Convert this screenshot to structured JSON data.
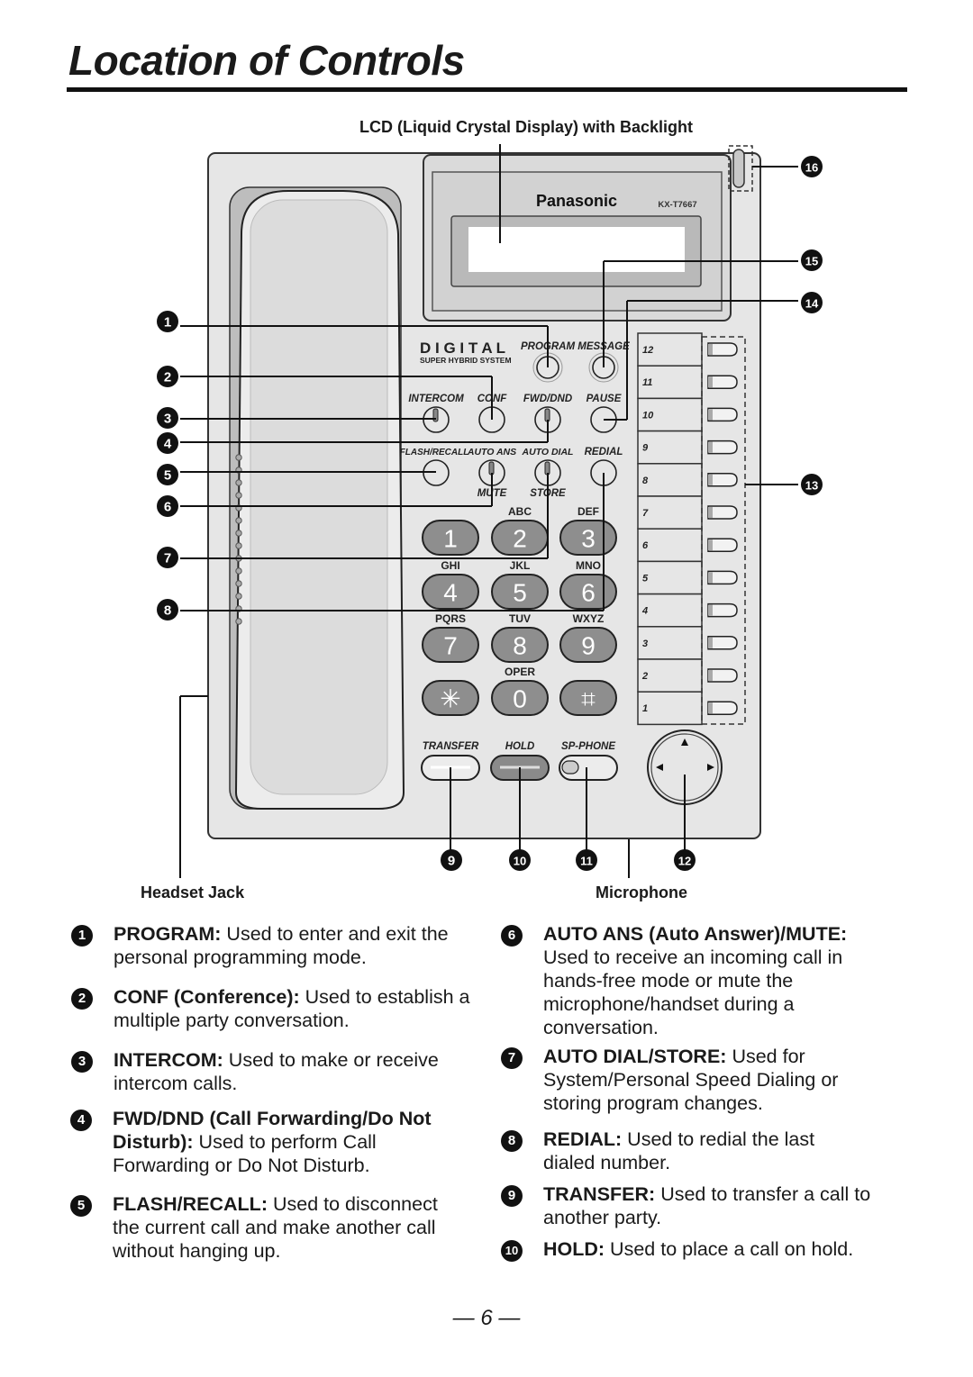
{
  "page": {
    "title": "Location of Controls",
    "page_number": "— 6 —"
  },
  "callouts": {
    "lcd": "LCD (Liquid Crystal Display) with Backlight",
    "headset_jack": "Headset Jack",
    "microphone": "Microphone"
  },
  "phone": {
    "brand": "Panasonic",
    "model": "KX-T7667",
    "series_title": "D I G I T A L",
    "series_subtitle": "SUPER HYBRID SYSTEM",
    "function_buttons": {
      "program": "PROGRAM",
      "message": "MESSAGE",
      "intercom": "INTERCOM",
      "conf": "CONF",
      "fwd_dnd": "FWD/DND",
      "pause": "PAUSE",
      "flash_recall": "FLASH/RECALL",
      "auto_ans": "AUTO ANS",
      "auto_dial": "AUTO DIAL",
      "redial": "REDIAL",
      "mute": "MUTE",
      "store": "STORE",
      "transfer": "TRANSFER",
      "hold": "HOLD",
      "sp_phone": "SP-PHONE"
    },
    "keypad": [
      {
        "digit": "1",
        "letters": ""
      },
      {
        "digit": "2",
        "letters": "ABC"
      },
      {
        "digit": "3",
        "letters": "DEF"
      },
      {
        "digit": "4",
        "letters": "GHI"
      },
      {
        "digit": "5",
        "letters": "JKL"
      },
      {
        "digit": "6",
        "letters": "MNO"
      },
      {
        "digit": "7",
        "letters": "PQRS"
      },
      {
        "digit": "8",
        "letters": "TUV"
      },
      {
        "digit": "9",
        "letters": "WXYZ"
      },
      {
        "digit": "✳",
        "letters": ""
      },
      {
        "digit": "0",
        "letters": "OPER"
      },
      {
        "digit": "⌗",
        "letters": ""
      }
    ],
    "dss_keys": [
      "12",
      "11",
      "10",
      "9",
      "8",
      "7",
      "6",
      "5",
      "4",
      "3",
      "2",
      "1"
    ]
  },
  "badges": [
    "1",
    "2",
    "3",
    "4",
    "5",
    "6",
    "7",
    "8",
    "9",
    "10",
    "11",
    "12",
    "13",
    "14",
    "15",
    "16"
  ],
  "descriptions": [
    {
      "num": "1",
      "term": "PROGRAM:",
      "text": " Used to enter and exit the personal programming mode."
    },
    {
      "num": "2",
      "term": "CONF (Conference):",
      "text": " Used to establish a multiple party conversation."
    },
    {
      "num": "3",
      "term": "INTERCOM:",
      "text": " Used to make or receive intercom calls."
    },
    {
      "num": "4",
      "term": "FWD/DND (Call Forwarding/Do Not Disturb):",
      "text": " Used to perform Call Forwarding or Do Not Disturb."
    },
    {
      "num": "5",
      "term": "FLASH/RECALL:",
      "text": " Used to disconnect the current call and make another call without hanging up."
    },
    {
      "num": "6",
      "term": "AUTO ANS (Auto Answer)/MUTE:",
      "text": " Used to receive an incoming call in hands-free mode or mute the microphone/handset during a conversation."
    },
    {
      "num": "7",
      "term": "AUTO DIAL/STORE:",
      "text": " Used for System/Personal Speed Dialing or storing program changes."
    },
    {
      "num": "8",
      "term": "REDIAL:",
      "text": " Used to redial the last dialed number."
    },
    {
      "num": "9",
      "term": "TRANSFER:",
      "text": " Used to transfer a call to another party."
    },
    {
      "num": "10",
      "term": "HOLD:",
      "text": " Used to place a call on hold."
    }
  ]
}
